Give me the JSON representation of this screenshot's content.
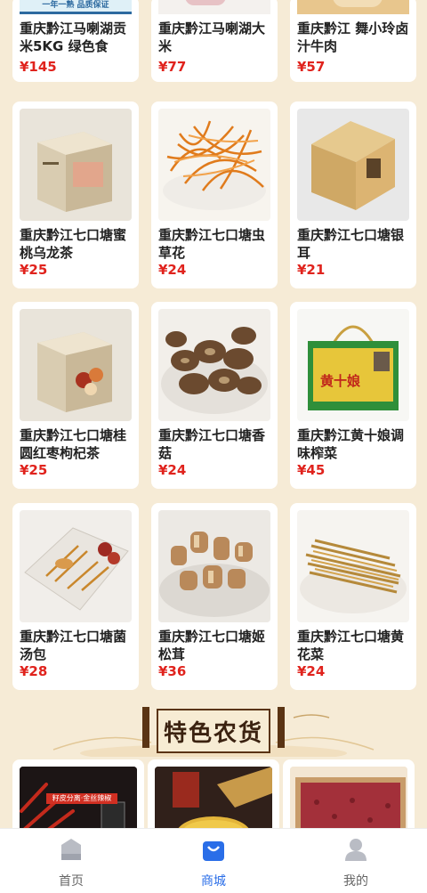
{
  "top_products": [
    {
      "name": "重庆黔江马喇湖贡米5KG 绿色食品...",
      "price": "¥145",
      "banner_text": "一年一熟  品质保证"
    },
    {
      "name": "重庆黔江马喇湖大米",
      "price": "¥77"
    },
    {
      "name": "重庆黔江 舞小玲卤汁牛肉",
      "price": "¥57"
    }
  ],
  "products": [
    {
      "name": "重庆黔江七口塘蜜桃乌龙茶",
      "price": "¥25",
      "icon": "tea-box-image"
    },
    {
      "name": "重庆黔江七口塘虫草花",
      "price": "¥24",
      "icon": "cordyceps-flower-image"
    },
    {
      "name": "重庆黔江七口塘银耳",
      "price": "¥21",
      "icon": "tremella-box-image"
    },
    {
      "name": "重庆黔江七口塘桂圆红枣枸杞茶",
      "price": "¥25",
      "icon": "tea-box-image"
    },
    {
      "name": "重庆黔江七口塘香菇",
      "price": "¥24",
      "icon": "shiitake-image"
    },
    {
      "name": "重庆黔江黄十娘调味榨菜",
      "price": "¥45",
      "icon": "gift-box-image",
      "box_text": "黄十娘"
    },
    {
      "name": "重庆黔江七口塘菌汤包",
      "price": "¥28",
      "icon": "mushroom-soup-pack-image"
    },
    {
      "name": "重庆黔江七口塘姬松茸",
      "price": "¥36",
      "icon": "agaricus-image"
    },
    {
      "name": "重庆黔江七口塘黄花菜",
      "price": "¥24",
      "icon": "daylily-image"
    }
  ],
  "section": {
    "title": "特色农货"
  },
  "featured": [
    {
      "icon": "chili-image",
      "overlay_text": "籽皮分离·金丝辣椒"
    },
    {
      "icon": "millet-image"
    },
    {
      "icon": "red-bean-image"
    }
  ],
  "tabbar": [
    {
      "label": "首页",
      "icon": "home-icon",
      "active": false
    },
    {
      "label": "商城",
      "icon": "shopping-bag-icon",
      "active": true
    },
    {
      "label": "我的",
      "icon": "user-icon",
      "active": false
    }
  ],
  "colors": {
    "background": "#f6ebd6",
    "price": "#e0231d",
    "active_tab": "#2a6ee8",
    "inactive_tab": "#b9bcc4"
  }
}
